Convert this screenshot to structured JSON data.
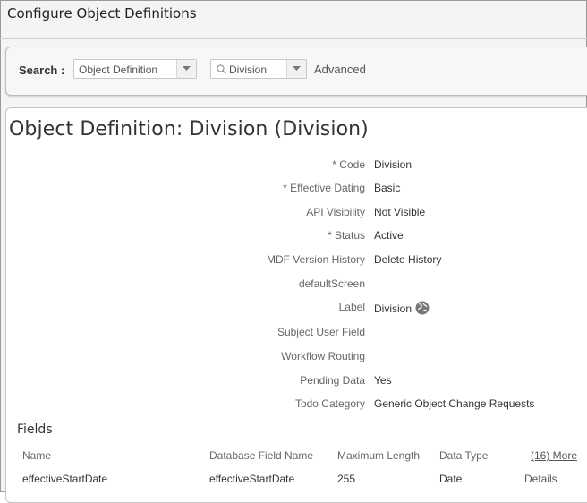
{
  "header": {
    "title": "Configure Object Definitions"
  },
  "search": {
    "label": "Search :",
    "object_select": "Object Definition",
    "instance_select": "Division",
    "advanced_label": "Advanced"
  },
  "object": {
    "title": "Object Definition: Division (Division)",
    "properties": [
      {
        "label": "* Code",
        "value": "Division"
      },
      {
        "label": "* Effective Dating",
        "value": "Basic"
      },
      {
        "label": "API Visibility",
        "value": "Not Visible"
      },
      {
        "label": "* Status",
        "value": "Active"
      },
      {
        "label": "MDF Version History",
        "value": "Delete History"
      },
      {
        "label": "defaultScreen",
        "value": ""
      },
      {
        "label": "Label",
        "value": "Division"
      },
      {
        "label": "Subject User Field",
        "value": ""
      },
      {
        "label": "Workflow Routing",
        "value": ""
      },
      {
        "label": "Pending Data",
        "value": "Yes"
      },
      {
        "label": "Todo Category",
        "value": "Generic Object Change Requests"
      }
    ]
  },
  "fields": {
    "heading": "Fields",
    "columns": [
      "Name",
      "Database Field Name",
      "Maximum Length",
      "Data Type"
    ],
    "more_link": "(16) More",
    "rows": [
      {
        "name": "effectiveStartDate",
        "db_field": "effectiveStartDate",
        "max_length": "255",
        "data_type": "Date",
        "action": "Details"
      }
    ]
  }
}
